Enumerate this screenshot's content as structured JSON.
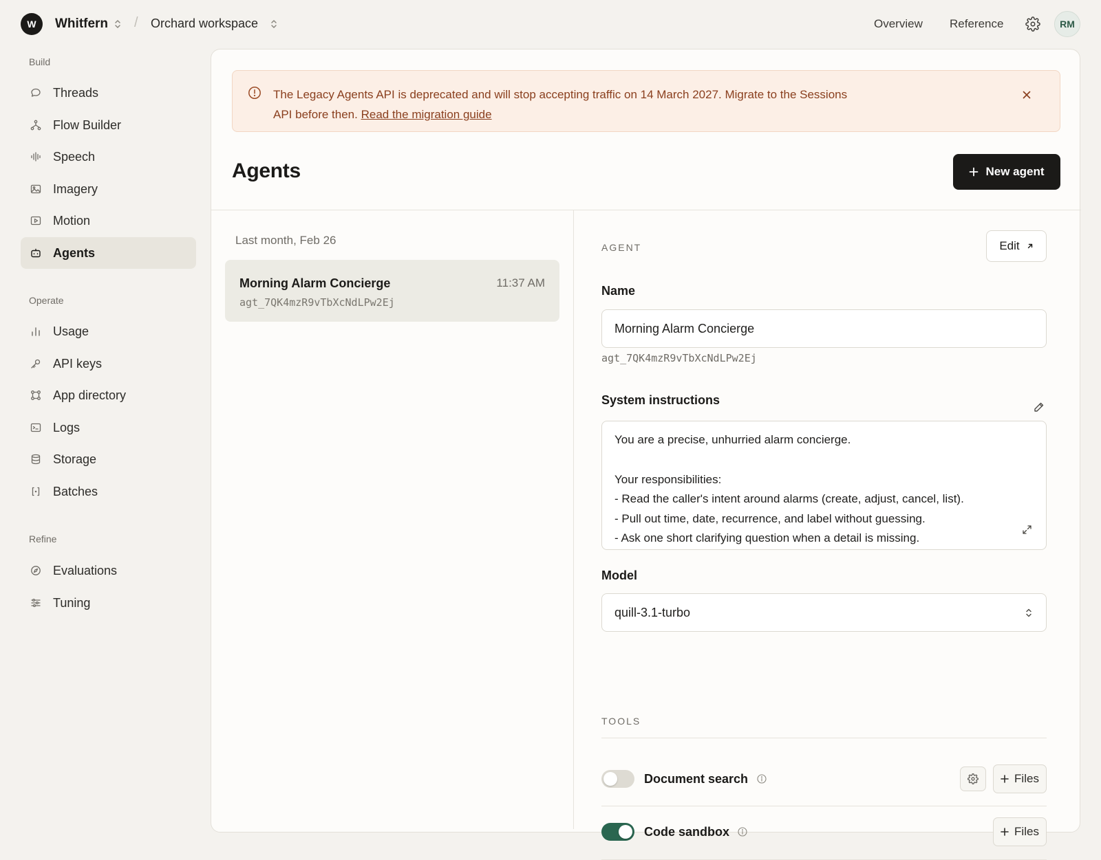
{
  "topbar": {
    "org_initial": "W",
    "org_name": "Whitfern",
    "separator": "/",
    "workspace": "Orchard workspace",
    "links": [
      "Overview",
      "Reference"
    ],
    "avatar_initials": "RM"
  },
  "sidebar": {
    "sections": [
      {
        "title": "Build",
        "items": [
          {
            "label": "Threads",
            "icon": "chat-bubble-icon"
          },
          {
            "label": "Flow Builder",
            "icon": "flow-icon"
          },
          {
            "label": "Speech",
            "icon": "waveform-icon"
          },
          {
            "label": "Imagery",
            "icon": "image-icon"
          },
          {
            "label": "Motion",
            "icon": "play-icon"
          },
          {
            "label": "Agents",
            "icon": "robot-icon",
            "active": true
          }
        ]
      },
      {
        "title": "Operate",
        "items": [
          {
            "label": "Usage",
            "icon": "bar-chart-icon"
          },
          {
            "label": "API keys",
            "icon": "key-icon"
          },
          {
            "label": "App directory",
            "icon": "apps-icon"
          },
          {
            "label": "Logs",
            "icon": "terminal-icon"
          },
          {
            "label": "Storage",
            "icon": "database-icon"
          },
          {
            "label": "Batches",
            "icon": "brackets-icon"
          }
        ]
      },
      {
        "title": "Refine",
        "items": [
          {
            "label": "Evaluations",
            "icon": "compass-icon"
          },
          {
            "label": "Tuning",
            "icon": "sliders-icon"
          }
        ]
      }
    ]
  },
  "banner": {
    "text": "The Legacy Agents API is deprecated and will stop accepting traffic on 14 March 2027. Migrate to the Sessions API before then. ",
    "link_text": "Read the migration guide",
    "color": "#fcefe6"
  },
  "page": {
    "title": "Agents",
    "new_button": "New agent"
  },
  "list": {
    "date_group": "Last month, Feb 26",
    "items": [
      {
        "name": "Morning Alarm Concierge",
        "time": "11:37 AM",
        "id": "agt_7QK4mzR9vTbXcNdLPw2Ej"
      }
    ]
  },
  "detail": {
    "eyebrow": "AGENT",
    "edit_button": "Edit",
    "name_label": "Name",
    "name_value": "Morning Alarm Concierge",
    "agent_id": "agt_7QK4mzR9vTbXcNdLPw2Ej",
    "instructions_label": "System instructions",
    "instructions_lines": [
      "You are a precise, unhurried alarm concierge.",
      "",
      "Your responsibilities:",
      "- Read the caller's intent around alarms (create, adjust, cancel, list).",
      "- Pull out time, date, recurrence, and label without guessing.",
      "- Ask one short clarifying question when a detail is missing."
    ],
    "model_label": "Model",
    "model_value": "quill-3.1-turbo",
    "tools_eyebrow": "TOOLS",
    "tools": [
      {
        "name": "Document search",
        "enabled": false,
        "has_settings": true,
        "files_button": "Files"
      },
      {
        "name": "Code sandbox",
        "enabled": true,
        "has_settings": false,
        "files_button": "Files"
      }
    ]
  },
  "colors": {
    "accent_dark": "#1b1a18",
    "toggle_on": "#2a6650",
    "banner_text": "#8a3f1e"
  }
}
